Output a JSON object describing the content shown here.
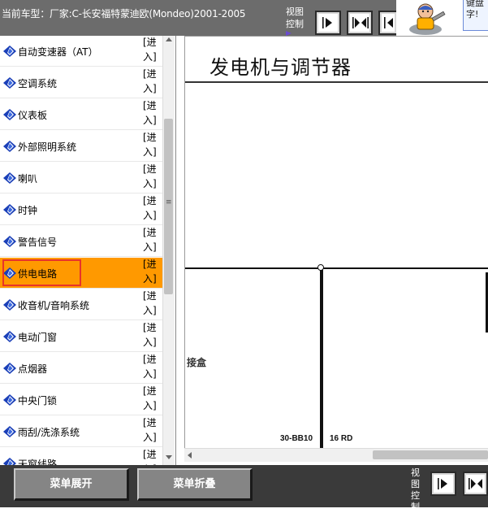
{
  "header": {
    "vehicle_info": "当前车型：厂家:C-长安福特蒙迪欧(Mondeo)2001-2005",
    "view_control_label_line1": "视图",
    "view_control_label_line2": "控制",
    "ad_text_line1": "键盘",
    "ad_text_line2": "字!"
  },
  "sidebar": {
    "enter_line1": "[进",
    "enter_line2": "入]",
    "items": [
      {
        "label": "自动变速器（AT）"
      },
      {
        "label": "空调系统"
      },
      {
        "label": "仪表板"
      },
      {
        "label": "外部照明系统"
      },
      {
        "label": "喇叭"
      },
      {
        "label": "时钟"
      },
      {
        "label": "警告信号"
      },
      {
        "label": "供电电路",
        "selected": true
      },
      {
        "label": "收音机/音响系统"
      },
      {
        "label": "电动门窗"
      },
      {
        "label": "点烟器"
      },
      {
        "label": "中央门锁"
      },
      {
        "label": "雨刮/洗涤系统"
      },
      {
        "label": "天窗线路"
      }
    ],
    "scroll_grip": "≡"
  },
  "diagram": {
    "title": "发电机与调节器",
    "junction_label": "接盒",
    "wire_code": "30-BB10",
    "wire_color": "16 RD"
  },
  "footer": {
    "expand_label": "菜单展开",
    "collapse_label": "菜单折叠",
    "view_control_label": "视图控制"
  },
  "colors": {
    "selected_bg": "#ff9900",
    "selection_outline": "#e8332a",
    "icon_blue": "#1a3fb8"
  }
}
